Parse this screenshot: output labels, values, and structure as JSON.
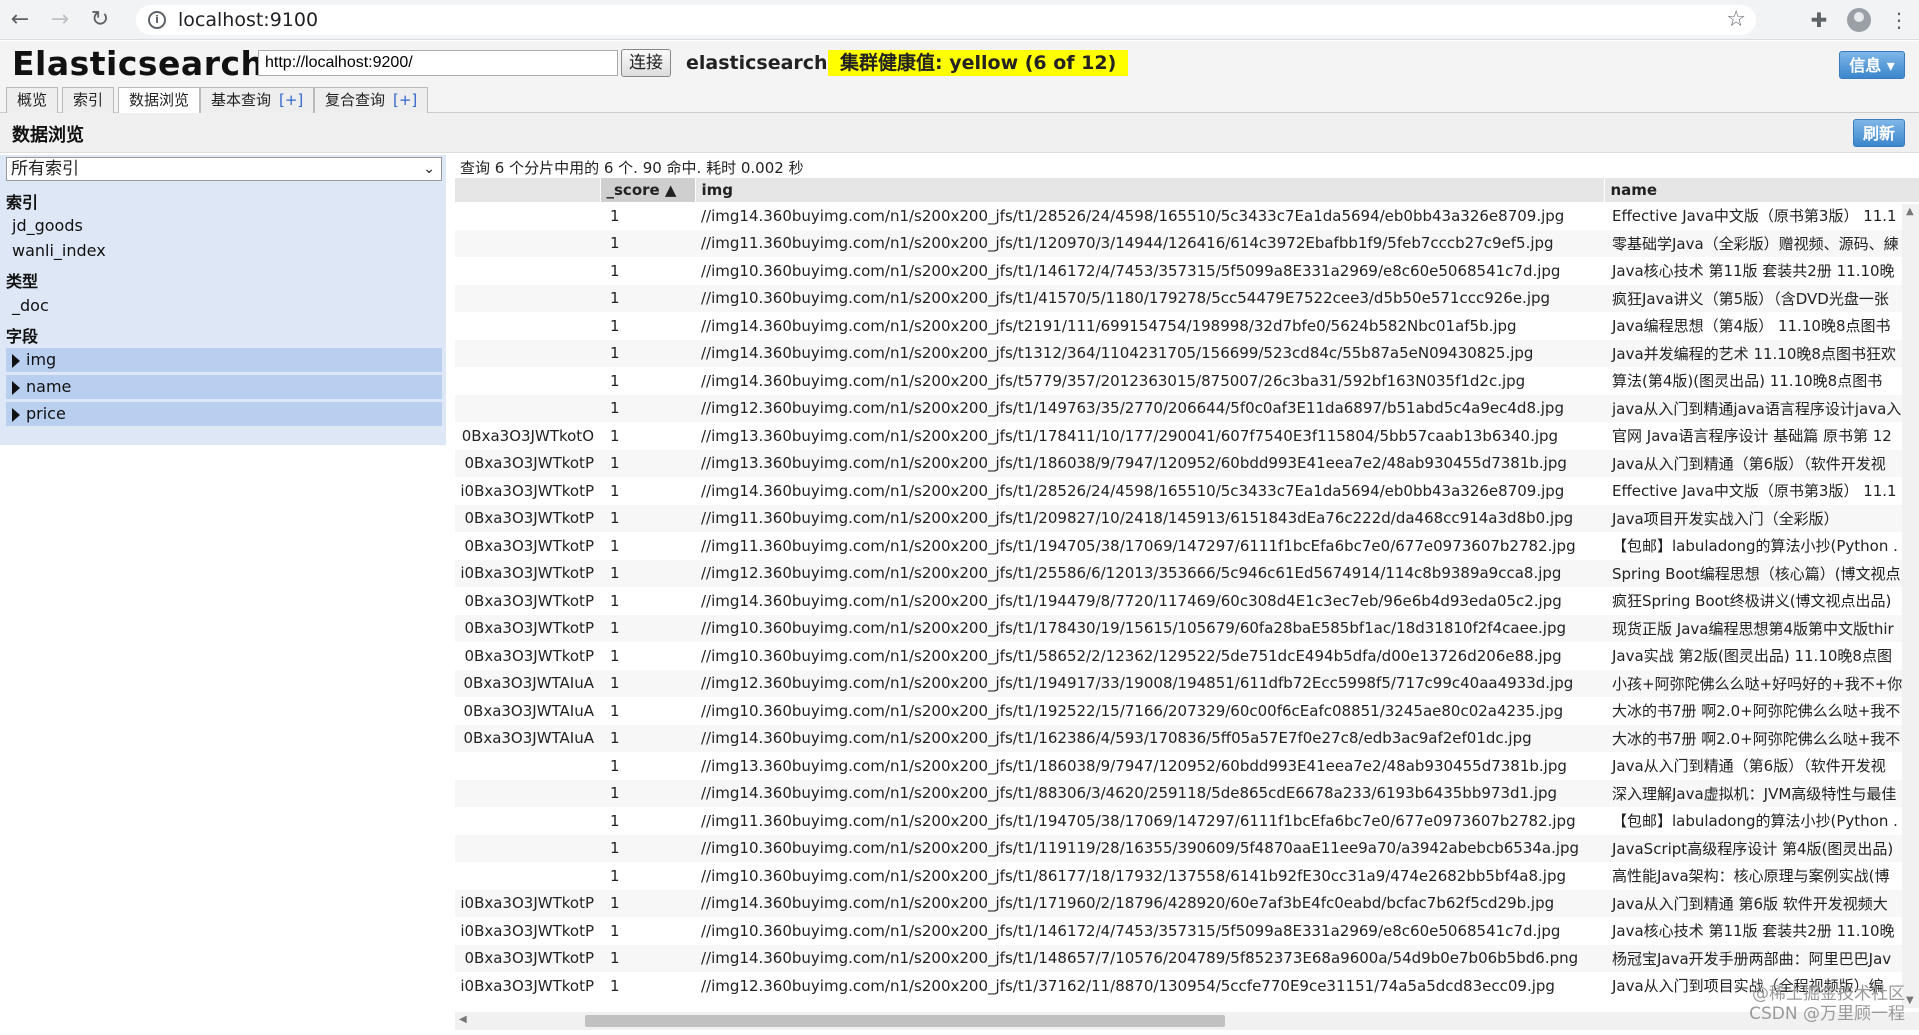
{
  "browser": {
    "url": "localhost:9100"
  },
  "header": {
    "title": "Elasticsearch",
    "es_url": "http://localhost:9200/",
    "connect_label": "连接",
    "cluster_name": "elasticsearch",
    "health": "集群健康值: yellow (6 of 12)",
    "info_label": "信息 ▾"
  },
  "tabs": {
    "overview": "概览",
    "indices": "索引",
    "browser": "数据浏览",
    "basic_query": "基本查询",
    "complex_query": "复合查询",
    "plus": "[+]"
  },
  "page": {
    "title": "数据浏览",
    "refresh_label": "刷新"
  },
  "sidebar": {
    "select_value": "所有索引",
    "section_indices": "索引",
    "indices": [
      "jd_goods",
      "wanli_index"
    ],
    "section_types": "类型",
    "types": [
      "_doc"
    ],
    "section_fields": "字段",
    "fields": [
      "img",
      "name",
      "price"
    ]
  },
  "results": {
    "status": "查询 6 个分片中用的 6 个. 90 命中. 耗时 0.002 秒",
    "columns": {
      "id": "",
      "score": "_score ▲",
      "img": "img",
      "name": "name"
    },
    "rows": [
      {
        "id": "",
        "score": "1",
        "img": "//img14.360buyimg.com/n1/s200x200_jfs/t1/28526/24/4598/165510/5c3433c7Ea1da5694/eb0bb43a326e8709.jpg",
        "name": "Effective Java中文版（原书第3版） 11.1"
      },
      {
        "id": "",
        "score": "1",
        "img": "//img11.360buyimg.com/n1/s200x200_jfs/t1/120970/3/14944/126416/614c3972Ebafbb1f9/5feb7cccb27c9ef5.jpg",
        "name": "零基础学Java（全彩版）赠视频、源码、練"
      },
      {
        "id": "",
        "score": "1",
        "img": "//img10.360buyimg.com/n1/s200x200_jfs/t1/146172/4/7453/357315/5f5099a8E331a2969/e8c60e5068541c7d.jpg",
        "name": "Java核心技术 第11版 套装共2册 11.10晚"
      },
      {
        "id": "",
        "score": "1",
        "img": "//img10.360buyimg.com/n1/s200x200_jfs/t1/41570/5/1180/179278/5cc54479E7522cee3/d5b50e571ccc926e.jpg",
        "name": "疯狂Java讲义（第5版）（含DVD光盘一张"
      },
      {
        "id": "",
        "score": "1",
        "img": "//img14.360buyimg.com/n1/s200x200_jfs/t2191/111/699154754/198998/32d7bfe0/5624b582Nbc01af5b.jpg",
        "name": "Java编程思想（第4版） 11.10晚8点图书"
      },
      {
        "id": "",
        "score": "1",
        "img": "//img14.360buyimg.com/n1/s200x200_jfs/t1312/364/1104231705/156699/523cd84c/55b87a5eN09430825.jpg",
        "name": "Java并发编程的艺术 11.10晚8点图书狂欢"
      },
      {
        "id": "",
        "score": "1",
        "img": "//img14.360buyimg.com/n1/s200x200_jfs/t5779/357/2012363015/875007/26c3ba31/592bf163N035f1d2c.jpg",
        "name": "算法(第4版)(图灵出品) 11.10晚8点图书"
      },
      {
        "id": "",
        "score": "1",
        "img": "//img12.360buyimg.com/n1/s200x200_jfs/t1/149763/35/2770/206644/5f0c0af3E11da6897/b51abd5c4a9ec4d8.jpg",
        "name": "java从入门到精通java语言程序设计java入"
      },
      {
        "id": "0Bxa3O3JWTkotO",
        "score": "1",
        "img": "//img13.360buyimg.com/n1/s200x200_jfs/t1/178411/10/177/290041/607f7540E3f115804/5bb57caab13b6340.jpg",
        "name": "官网 Java语言程序设计 基础篇 原书第 12"
      },
      {
        "id": "0Bxa3O3JWTkotP",
        "score": "1",
        "img": "//img13.360buyimg.com/n1/s200x200_jfs/t1/186038/9/7947/120952/60bdd993E41eea7e2/48ab930455d7381b.jpg",
        "name": "Java从入门到精通（第6版）（软件开发视"
      },
      {
        "id": "i0Bxa3O3JWTkotP",
        "score": "1",
        "img": "//img14.360buyimg.com/n1/s200x200_jfs/t1/28526/24/4598/165510/5c3433c7Ea1da5694/eb0bb43a326e8709.jpg",
        "name": "Effective Java中文版（原书第3版） 11.1"
      },
      {
        "id": "0Bxa3O3JWTkotP",
        "score": "1",
        "img": "//img11.360buyimg.com/n1/s200x200_jfs/t1/209827/10/2418/145913/6151843dEa76c222d/da468cc914a3d8b0.jpg",
        "name": "Java项目开发实战入门（全彩版）"
      },
      {
        "id": "0Bxa3O3JWTkotP",
        "score": "1",
        "img": "//img11.360buyimg.com/n1/s200x200_jfs/t1/194705/38/17069/147297/6111f1bcEfa6bc7e0/677e0973607b2782.jpg",
        "name": "【包邮】labuladong的算法小抄(Python ."
      },
      {
        "id": "i0Bxa3O3JWTkotP",
        "score": "1",
        "img": "//img12.360buyimg.com/n1/s200x200_jfs/t1/25586/6/12013/353666/5c946c61Ed5674914/114c8b9389a9cca8.jpg",
        "name": "Spring Boot编程思想（核心篇）(博文视点"
      },
      {
        "id": "0Bxa3O3JWTkotP",
        "score": "1",
        "img": "//img14.360buyimg.com/n1/s200x200_jfs/t1/194479/8/7720/117469/60c308d4E1c3ec7eb/96e6b4d93eda05c2.jpg",
        "name": "疯狂Spring Boot终极讲义(博文视点出品)"
      },
      {
        "id": "0Bxa3O3JWTkotP",
        "score": "1",
        "img": "//img10.360buyimg.com/n1/s200x200_jfs/t1/178430/19/15615/105679/60fa28baE585bf1ac/18d31810f2f4caee.jpg",
        "name": "现货正版 Java编程思想第4版第中文版thir"
      },
      {
        "id": "0Bxa3O3JWTkotP",
        "score": "1",
        "img": "//img10.360buyimg.com/n1/s200x200_jfs/t1/58652/2/12362/129522/5de751dcE494b5dfa/d00e13726d206e88.jpg",
        "name": "Java实战 第2版(图灵出品) 11.10晚8点图"
      },
      {
        "id": "0Bxa3O3JWTAIuA",
        "score": "1",
        "img": "//img12.360buyimg.com/n1/s200x200_jfs/t1/194917/33/19008/194851/611dfb72Ecc5998f5/717c99c40aa4933d.jpg",
        "name": "小孩+阿弥陀佛么么哒+好吗好的+我不+你"
      },
      {
        "id": "0Bxa3O3JWTAIuA",
        "score": "1",
        "img": "//img10.360buyimg.com/n1/s200x200_jfs/t1/192522/15/7166/207329/60c00f6cEafc08851/3245ae80c02a4235.jpg",
        "name": "大冰的书7册 啊2.0+阿弥陀佛么么哒+我不"
      },
      {
        "id": "0Bxa3O3JWTAIuA",
        "score": "1",
        "img": "//img14.360buyimg.com/n1/s200x200_jfs/t1/162386/4/593/170836/5ff05a57E7f0e27c8/edb3ac9af2ef01dc.jpg",
        "name": "大冰的书7册 啊2.0+阿弥陀佛么么哒+我不"
      },
      {
        "id": "",
        "score": "1",
        "img": "//img13.360buyimg.com/n1/s200x200_jfs/t1/186038/9/7947/120952/60bdd993E41eea7e2/48ab930455d7381b.jpg",
        "name": "Java从入门到精通（第6版）（软件开发视"
      },
      {
        "id": "",
        "score": "1",
        "img": "//img14.360buyimg.com/n1/s200x200_jfs/t1/88306/3/4620/259118/5de865cdE6678a233/6193b6435bb973d1.jpg",
        "name": "深入理解Java虚拟机：JVM高级特性与最佳"
      },
      {
        "id": "",
        "score": "1",
        "img": "//img11.360buyimg.com/n1/s200x200_jfs/t1/194705/38/17069/147297/6111f1bcEfa6bc7e0/677e0973607b2782.jpg",
        "name": "【包邮】labuladong的算法小抄(Python ."
      },
      {
        "id": "",
        "score": "1",
        "img": "//img10.360buyimg.com/n1/s200x200_jfs/t1/119119/28/16355/390609/5f4870aaE11ee9a70/a3942abebcb6534a.jpg",
        "name": "JavaScript高级程序设计 第4版(图灵出品)"
      },
      {
        "id": "",
        "score": "1",
        "img": "//img10.360buyimg.com/n1/s200x200_jfs/t1/86177/18/17932/137558/6141b92fE30cc31a9/474e2682bb5bf4a8.jpg",
        "name": "高性能Java架构：核心原理与案例实战(博"
      },
      {
        "id": "i0Bxa3O3JWTkotP",
        "score": "1",
        "img": "//img14.360buyimg.com/n1/s200x200_jfs/t1/171960/2/18796/428920/60e7af3bE4fc0eabd/bcfac7b62f5cd29b.jpg",
        "name": "Java从入门到精通 第6版 软件开发视频大"
      },
      {
        "id": "i0Bxa3O3JWTkotP",
        "score": "1",
        "img": "//img10.360buyimg.com/n1/s200x200_jfs/t1/146172/4/7453/357315/5f5099a8E331a2969/e8c60e5068541c7d.jpg",
        "name": "Java核心技术 第11版 套装共2册 11.10晚"
      },
      {
        "id": "0Bxa3O3JWTkotP",
        "score": "1",
        "img": "//img14.360buyimg.com/n1/s200x200_jfs/t1/148657/7/10576/204789/5f852373E68a9600a/54d9b0e7b06b5bd6.png",
        "name": "杨冠宝Java开发手册两部曲：阿里巴巴Jav"
      },
      {
        "id": "i0Bxa3O3JWTkotP",
        "score": "1",
        "img": "//img12.360buyimg.com/n1/s200x200_jfs/t1/37162/11/8870/130954/5ccfe770E9ce31151/74a5a5dcd83ecc09.jpg",
        "name": "Java从入门到项目实战（全程视频版）编"
      }
    ]
  },
  "watermark": {
    "line1": "@稀土掘金技术社区",
    "line2": "CSDN @万里顾一程"
  }
}
